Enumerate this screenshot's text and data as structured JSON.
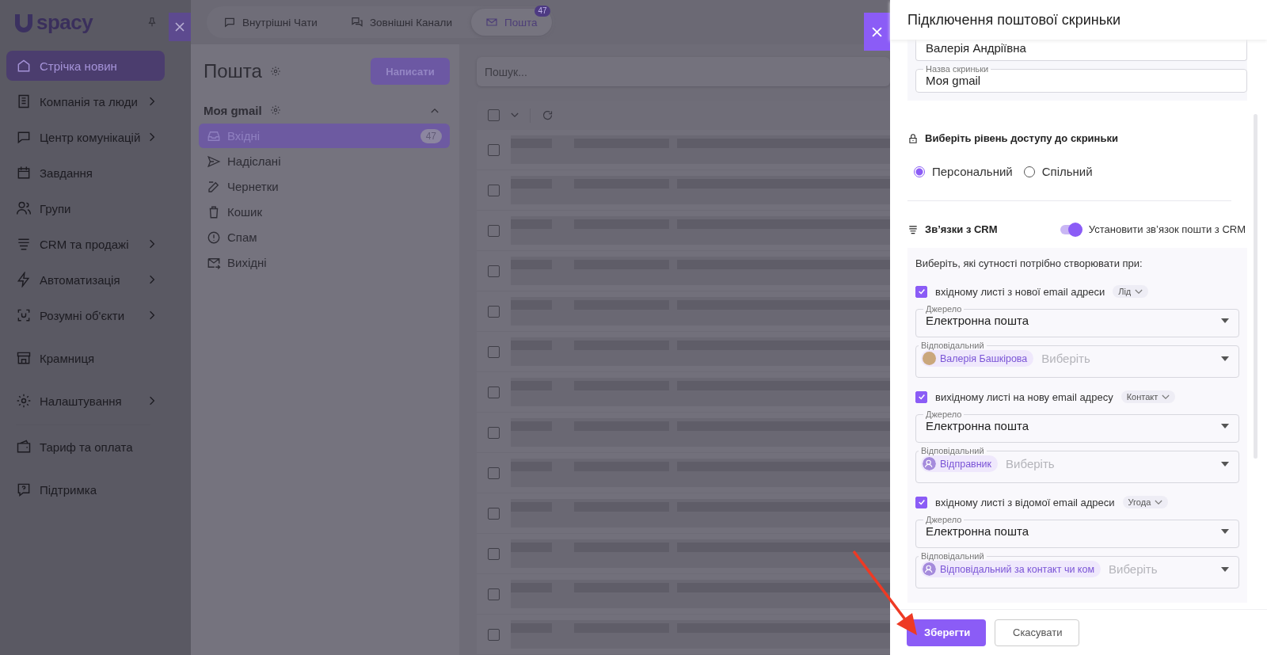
{
  "sidebar": {
    "logo": "spacy",
    "items": [
      {
        "label": "Стрічка новин",
        "selected": true,
        "submenu": false
      },
      {
        "label": "Компанія та люди",
        "selected": false,
        "submenu": true
      },
      {
        "label": "Центр комунікацій",
        "selected": false,
        "submenu": true
      },
      {
        "label": "Завдання",
        "selected": false,
        "submenu": false
      },
      {
        "label": "Групи",
        "selected": false,
        "submenu": false
      },
      {
        "label": "CRM та продажі",
        "selected": false,
        "submenu": true
      },
      {
        "label": "Автоматизація",
        "selected": false,
        "submenu": true
      },
      {
        "label": "Розумні об'єкти",
        "selected": false,
        "submenu": true
      },
      {
        "label": "Крамниця",
        "selected": false,
        "submenu": false
      },
      {
        "label": "Налаштування",
        "selected": false,
        "submenu": true
      }
    ],
    "bottom_items": [
      {
        "label": "Тариф та оплата",
        "selected": false
      },
      {
        "label": "Підтримка",
        "selected": false
      }
    ]
  },
  "top_tabs": [
    {
      "label": "Внутрішні Чати",
      "selected": false
    },
    {
      "label": "Зовнішні Канали",
      "selected": false
    },
    {
      "label": "Пошта",
      "selected": true,
      "badge": "47"
    }
  ],
  "mail_panel": {
    "title": "Пошта",
    "compose_button": "Написати",
    "mailbox": {
      "name": "Моя gmail",
      "expanded": true
    },
    "folders": [
      {
        "label": "Вхідні",
        "selected": true,
        "count": "47"
      },
      {
        "label": "Надіслані",
        "selected": false
      },
      {
        "label": "Чернетки",
        "selected": false
      },
      {
        "label": "Кошик",
        "selected": false
      },
      {
        "label": "Спам",
        "selected": false
      },
      {
        "label": "Вихідні",
        "selected": false
      }
    ]
  },
  "mail_list": {
    "search": {
      "placeholder": "Пошук..."
    },
    "select_all": {
      "checked": false
    },
    "rows": [
      {
        "checked": false
      },
      {
        "checked": false
      },
      {
        "checked": false
      },
      {
        "checked": false
      },
      {
        "checked": false
      },
      {
        "checked": false
      },
      {
        "checked": false
      },
      {
        "checked": false
      },
      {
        "checked": false
      },
      {
        "checked": false
      },
      {
        "checked": false
      },
      {
        "checked": false
      },
      {
        "checked": false
      }
    ]
  },
  "drawer": {
    "title": "Підключення поштової скриньки",
    "fields": [
      {
        "value": "Валерія Андріївна"
      },
      {
        "label": "Назва скриньки",
        "value": "Моя gmail"
      }
    ],
    "access": {
      "heading": "Виберіть рівень доступу до скриньки",
      "options": [
        {
          "label": "Персональний",
          "selected": true
        },
        {
          "label": "Спільний",
          "selected": false
        }
      ]
    },
    "crm": {
      "heading": "Зв’язки з CRM",
      "toggle": {
        "label": "Установити зв’язок пошти з CRM",
        "on": true
      },
      "intro": "Виберіть, які сутності потрібно створювати при:",
      "rules": [
        {
          "label": "вхідному листі з нової email адреси",
          "checked": true,
          "entity": "Лід",
          "source": {
            "label": "Джерело",
            "value": "Електронна пошта"
          },
          "responsible": {
            "label": "Відповідальний",
            "chip": "Валерія Башкірова",
            "kind": "photo",
            "placeholder": "Виберіть"
          }
        },
        {
          "label": "вихідному листі на нову email адресу",
          "checked": true,
          "entity": "Контакт",
          "source": {
            "label": "Джерело",
            "value": "Електронна пошта"
          },
          "responsible": {
            "label": "Відповідальний",
            "chip": "Відправник",
            "kind": "person",
            "placeholder": "Виберіть"
          }
        },
        {
          "label": "вхідному листі з відомої email адреси",
          "checked": true,
          "entity": "Угода",
          "source": {
            "label": "Джерело",
            "value": "Електронна пошта"
          },
          "responsible": {
            "label": "Відповідальний",
            "chip": "Відповідальний за контакт чи ком",
            "kind": "person",
            "placeholder": "Виберіть"
          }
        }
      ]
    },
    "buttons": [
      {
        "label": "Зберегти",
        "kind": "primary"
      },
      {
        "label": "Скасувати",
        "kind": "secondary"
      }
    ]
  }
}
